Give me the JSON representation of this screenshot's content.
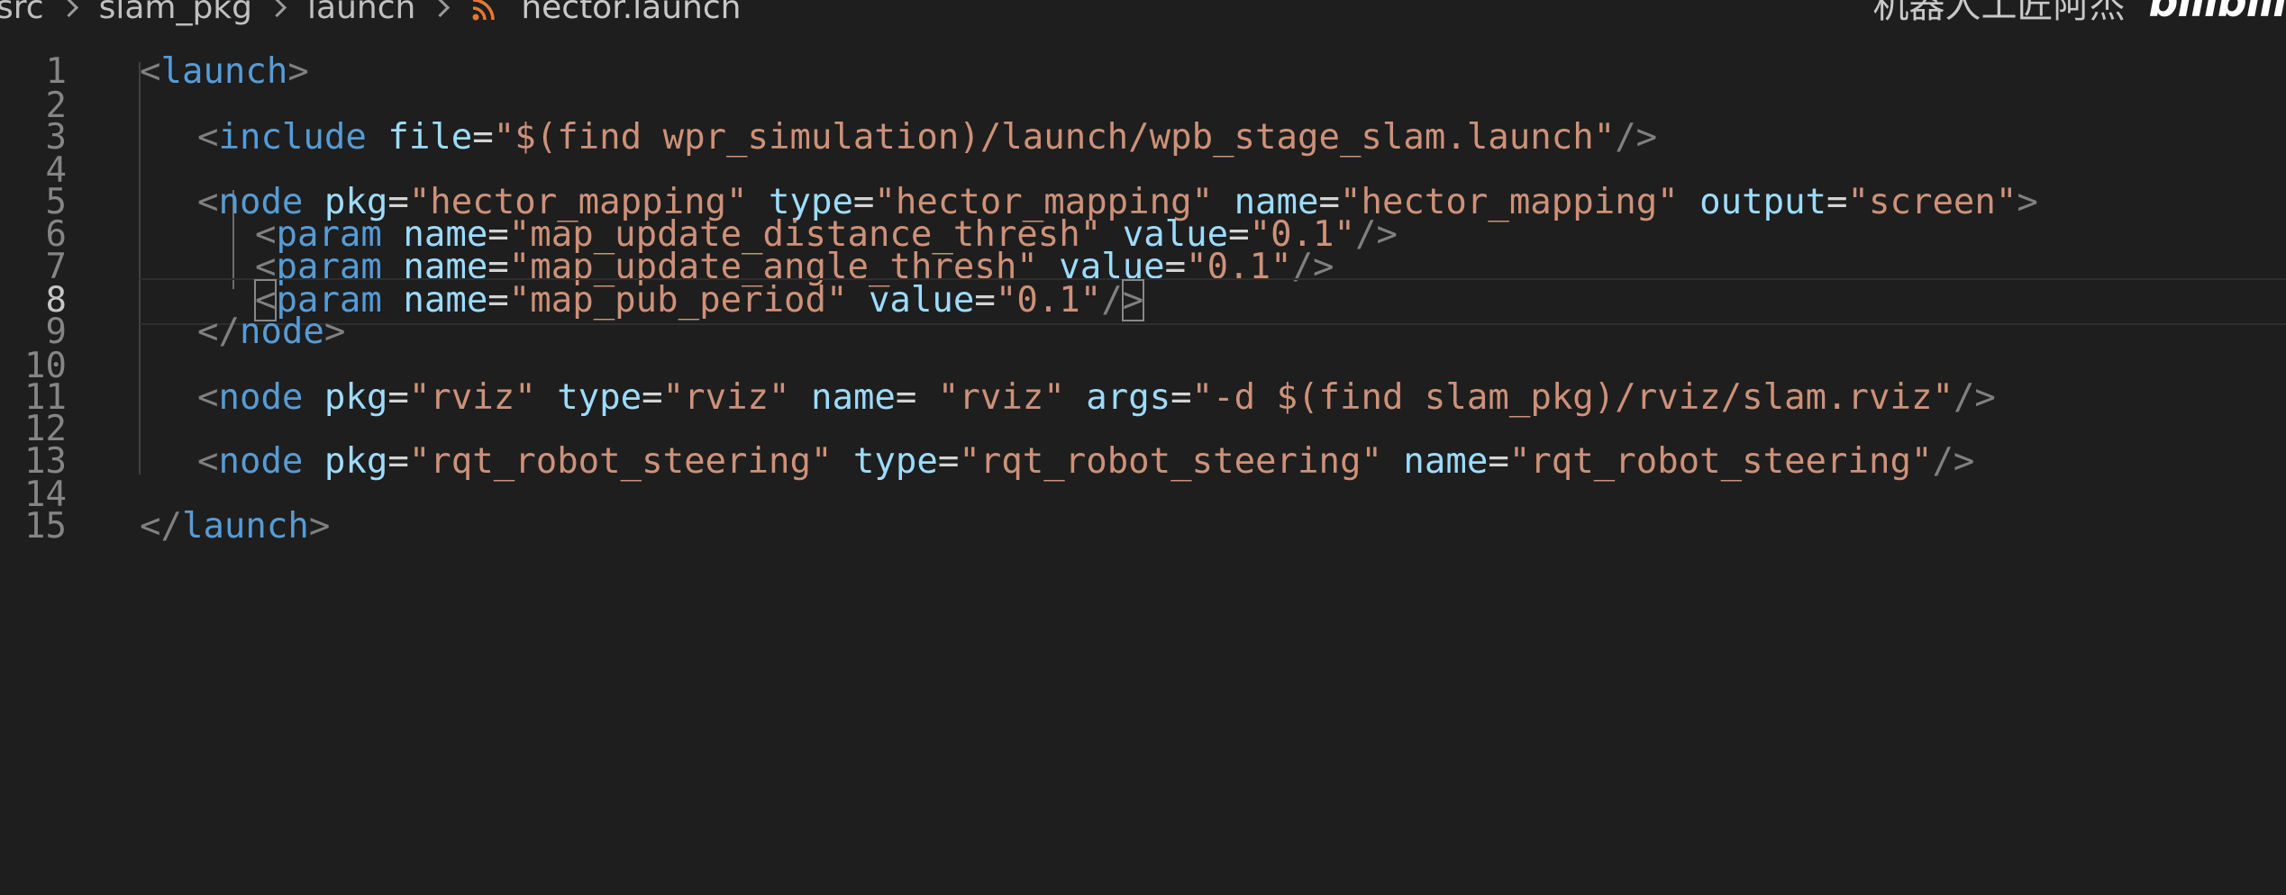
{
  "breadcrumb": {
    "items": [
      "src",
      "slam_pkg",
      "launch"
    ],
    "file": "hector.launch",
    "file_icon": "rss-feed-icon"
  },
  "watermark": {
    "text": "机器人工匠阿杰",
    "logo": "bilibili"
  },
  "colors": {
    "background": "#1e1e1e",
    "tag": "#569cd6",
    "attribute": "#9cdcfe",
    "string": "#ce9178",
    "punctuation": "#808080",
    "line_number": "#858585"
  },
  "editor": {
    "active_line": 8,
    "lines": [
      {
        "num": "1",
        "indent": 0,
        "tokens": [
          [
            "p",
            "<"
          ],
          [
            "t",
            "launch"
          ],
          [
            "p",
            ">"
          ]
        ]
      },
      {
        "num": "2",
        "indent": 0,
        "tokens": []
      },
      {
        "num": "3",
        "indent": 1,
        "tokens": [
          [
            "p",
            "<"
          ],
          [
            "t",
            "include"
          ],
          [
            "e",
            " "
          ],
          [
            "a",
            "file"
          ],
          [
            "e",
            "="
          ],
          [
            "s",
            "\"$(find wpr_simulation)/launch/wpb_stage_slam.launch\""
          ],
          [
            "p",
            "/>"
          ]
        ]
      },
      {
        "num": "4",
        "indent": 0,
        "tokens": []
      },
      {
        "num": "5",
        "indent": 1,
        "tokens": [
          [
            "p",
            "<"
          ],
          [
            "t",
            "node"
          ],
          [
            "e",
            " "
          ],
          [
            "a",
            "pkg"
          ],
          [
            "e",
            "="
          ],
          [
            "s",
            "\"hector_mapping\""
          ],
          [
            "e",
            " "
          ],
          [
            "a",
            "type"
          ],
          [
            "e",
            "="
          ],
          [
            "s",
            "\"hector_mapping\""
          ],
          [
            "e",
            " "
          ],
          [
            "a",
            "name"
          ],
          [
            "e",
            "="
          ],
          [
            "s",
            "\"hector_mapping\""
          ],
          [
            "e",
            " "
          ],
          [
            "a",
            "output"
          ],
          [
            "e",
            "="
          ],
          [
            "s",
            "\"screen\""
          ],
          [
            "p",
            ">"
          ]
        ]
      },
      {
        "num": "6",
        "indent": 2,
        "tokens": [
          [
            "p",
            "<"
          ],
          [
            "t",
            "param"
          ],
          [
            "e",
            " "
          ],
          [
            "a",
            "name"
          ],
          [
            "e",
            "="
          ],
          [
            "s",
            "\"map_update_distance_thresh\""
          ],
          [
            "e",
            " "
          ],
          [
            "a",
            "value"
          ],
          [
            "e",
            "="
          ],
          [
            "s",
            "\"0.1\""
          ],
          [
            "p",
            "/>"
          ]
        ]
      },
      {
        "num": "7",
        "indent": 2,
        "tokens": [
          [
            "p",
            "<"
          ],
          [
            "t",
            "param"
          ],
          [
            "e",
            " "
          ],
          [
            "a",
            "name"
          ],
          [
            "e",
            "="
          ],
          [
            "s",
            "\"map_update_angle_thresh\""
          ],
          [
            "e",
            " "
          ],
          [
            "a",
            "value"
          ],
          [
            "e",
            "="
          ],
          [
            "s",
            "\"0.1\""
          ],
          [
            "p",
            "/>"
          ]
        ]
      },
      {
        "num": "8",
        "indent": 2,
        "tokens": [
          [
            "pb",
            "<"
          ],
          [
            "t",
            "param"
          ],
          [
            "e",
            " "
          ],
          [
            "a",
            "name"
          ],
          [
            "e",
            "="
          ],
          [
            "s",
            "\"map_pub_period\""
          ],
          [
            "e",
            " "
          ],
          [
            "a",
            "value"
          ],
          [
            "e",
            "="
          ],
          [
            "s",
            "\"0.1\""
          ],
          [
            "p",
            "/"
          ],
          [
            "pb",
            ">"
          ]
        ]
      },
      {
        "num": "9",
        "indent": 1,
        "tokens": [
          [
            "p",
            "</"
          ],
          [
            "t",
            "node"
          ],
          [
            "p",
            ">"
          ]
        ]
      },
      {
        "num": "10",
        "indent": 0,
        "tokens": []
      },
      {
        "num": "11",
        "indent": 1,
        "tokens": [
          [
            "p",
            "<"
          ],
          [
            "t",
            "node"
          ],
          [
            "e",
            " "
          ],
          [
            "a",
            "pkg"
          ],
          [
            "e",
            "="
          ],
          [
            "s",
            "\"rviz\""
          ],
          [
            "e",
            " "
          ],
          [
            "a",
            "type"
          ],
          [
            "e",
            "="
          ],
          [
            "s",
            "\"rviz\""
          ],
          [
            "e",
            " "
          ],
          [
            "a",
            "name"
          ],
          [
            "e",
            "= "
          ],
          [
            "s",
            "\"rviz\""
          ],
          [
            "e",
            " "
          ],
          [
            "a",
            "args"
          ],
          [
            "e",
            "="
          ],
          [
            "s",
            "\"-d $(find slam_pkg)/rviz/slam.rviz\""
          ],
          [
            "p",
            "/>"
          ]
        ]
      },
      {
        "num": "12",
        "indent": 0,
        "tokens": []
      },
      {
        "num": "13",
        "indent": 1,
        "tokens": [
          [
            "p",
            "<"
          ],
          [
            "t",
            "node"
          ],
          [
            "e",
            " "
          ],
          [
            "a",
            "pkg"
          ],
          [
            "e",
            "="
          ],
          [
            "s",
            "\"rqt_robot_steering\""
          ],
          [
            "e",
            " "
          ],
          [
            "a",
            "type"
          ],
          [
            "e",
            "="
          ],
          [
            "s",
            "\"rqt_robot_steering\""
          ],
          [
            "e",
            " "
          ],
          [
            "a",
            "name"
          ],
          [
            "e",
            "="
          ],
          [
            "s",
            "\"rqt_robot_steering\""
          ],
          [
            "p",
            "/>"
          ]
        ]
      },
      {
        "num": "14",
        "indent": 0,
        "tokens": []
      },
      {
        "num": "15",
        "indent": 0,
        "tokens": [
          [
            "p",
            "</"
          ],
          [
            "t",
            "launch"
          ],
          [
            "p",
            ">"
          ]
        ]
      }
    ]
  }
}
